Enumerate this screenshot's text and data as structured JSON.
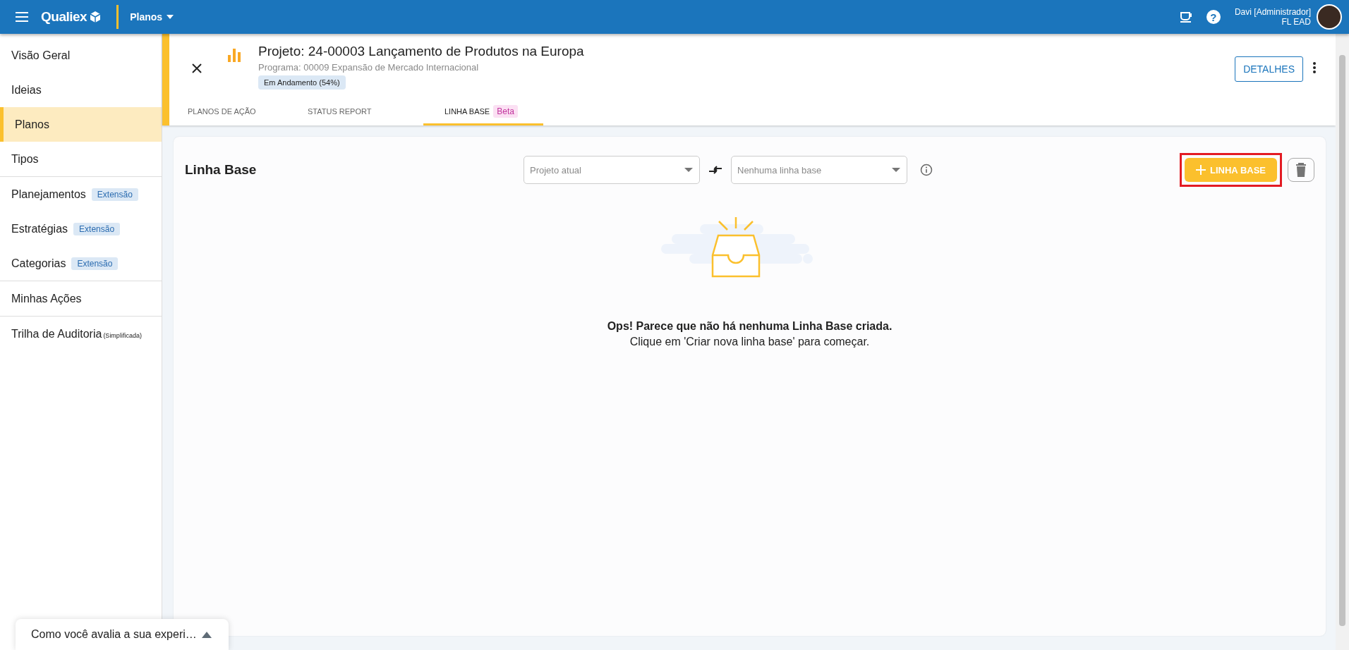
{
  "app_bar": {
    "logo": "Qualiex",
    "module": "Planos",
    "user_name": "Davi [Administrador]",
    "user_org": "FL EAD",
    "help_glyph": "?"
  },
  "sidebar": {
    "groups": [
      {
        "items": [
          {
            "label": "Visão Geral",
            "selected": false
          },
          {
            "label": "Ideias",
            "selected": false
          },
          {
            "label": "Planos",
            "selected": true
          },
          {
            "label": "Tipos",
            "selected": false
          }
        ]
      },
      {
        "items": [
          {
            "label": "Planejamentos",
            "badge": "Extensão",
            "selected": false
          },
          {
            "label": "Estratégias",
            "badge": "Extensão",
            "selected": false
          },
          {
            "label": "Categorias",
            "badge": "Extensão",
            "selected": false
          }
        ]
      },
      {
        "items": [
          {
            "label": "Minhas Ações",
            "selected": false
          }
        ]
      },
      {
        "items": [
          {
            "label": "Trilha de Auditoria",
            "note": "(Simplificada)",
            "selected": false
          }
        ]
      }
    ]
  },
  "project": {
    "title": "Projeto: 24-00003 Lançamento de Produtos na Europa",
    "program": "Programa: 00009 Expansão de Mercado Internacional",
    "status": "Em Andamento (54%)",
    "details_button": "DETALHES"
  },
  "tabs": [
    {
      "label": "PLANOS DE AÇÃO",
      "selected": false
    },
    {
      "label": "STATUS REPORT",
      "selected": false
    },
    {
      "label": "LINHA BASE",
      "badge": "Beta",
      "selected": true
    }
  ],
  "baseline": {
    "heading": "Linha Base",
    "left_select": {
      "placeholder": "Projeto atual"
    },
    "right_select": {
      "placeholder": "Nenhuma linha base"
    },
    "add_button": {
      "label": "LINHA BASE",
      "highlighted": true
    }
  },
  "empty_state": {
    "title": "Ops! Parece que não há nenhuma Linha Base criada.",
    "subtitle": "Clique em 'Criar nova linha base' para começar."
  },
  "feedback": {
    "text": "Como você avalia a sua experi…"
  }
}
